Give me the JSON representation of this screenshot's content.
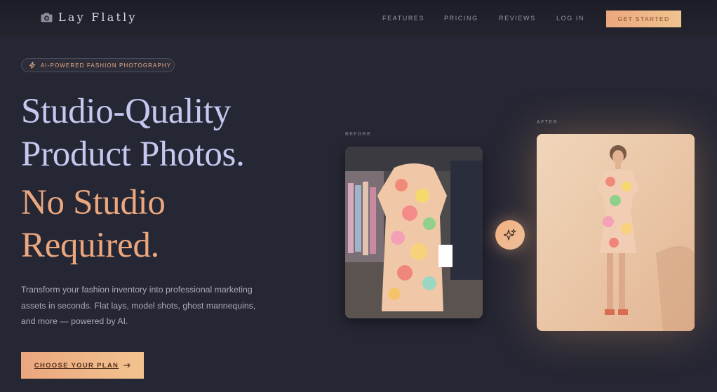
{
  "brand": {
    "name": "Lay Flatly",
    "icon": "camera-icon"
  },
  "nav": {
    "links": [
      {
        "label": "FEATURES"
      },
      {
        "label": "PRICING"
      },
      {
        "label": "REVIEWS"
      },
      {
        "label": "LOG IN"
      }
    ],
    "cta_label": "GET STARTED"
  },
  "hero": {
    "badge": {
      "icon": "lightning-icon",
      "label": "AI-POWERED FASHION PHOTOGRAPHY"
    },
    "headline_lines": [
      "Studio-Quality",
      "Product Photos.",
      "No Studio",
      "Required."
    ],
    "description": "Transform your fashion inventory into professional marketing assets in seconds. Flat lays, model shots, ghost mannequins, and more — powered by AI.",
    "cta_label": "CHOOSE YOUR PLAN",
    "cta_icon": "arrow-right-icon"
  },
  "comparison": {
    "before_label": "BEFORE",
    "after_label": "AFTER",
    "transform_icon": "sparkle-icon"
  },
  "colors": {
    "background": "#262734",
    "accent": "#eba77e",
    "headline_light": "#c5c8ef",
    "headline_accent": "#eba77e"
  }
}
